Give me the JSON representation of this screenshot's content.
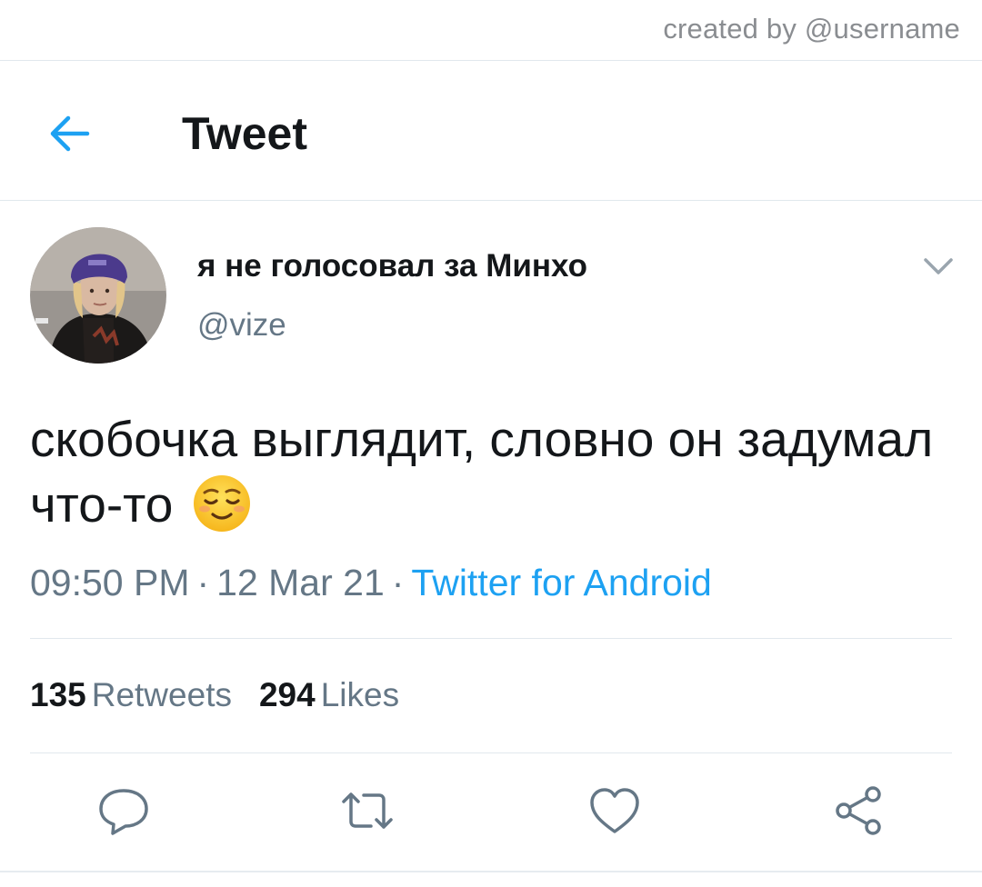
{
  "credit": "created by @username",
  "header": {
    "title": "Tweet",
    "back_icon": "arrow-left-icon"
  },
  "tweet": {
    "display_name": "я не голосовал за Минхо",
    "handle": "@vize",
    "text": "скобочка выглядит, словно он задумал что-то",
    "emoji": "relieved-face-emoji",
    "time": "09:50 PM",
    "date": "12 Mar 21",
    "separator": "·",
    "source": "Twitter for Android"
  },
  "stats": {
    "retweets_count": "135",
    "retweets_label": "Retweets",
    "likes_count": "294",
    "likes_label": "Likes"
  },
  "actions": [
    "reply-icon",
    "retweet-icon",
    "like-icon",
    "share-icon"
  ],
  "colors": {
    "accent": "#1da1f2",
    "text": "#14171a",
    "secondary": "#657786",
    "divider": "#e1e8ed"
  }
}
